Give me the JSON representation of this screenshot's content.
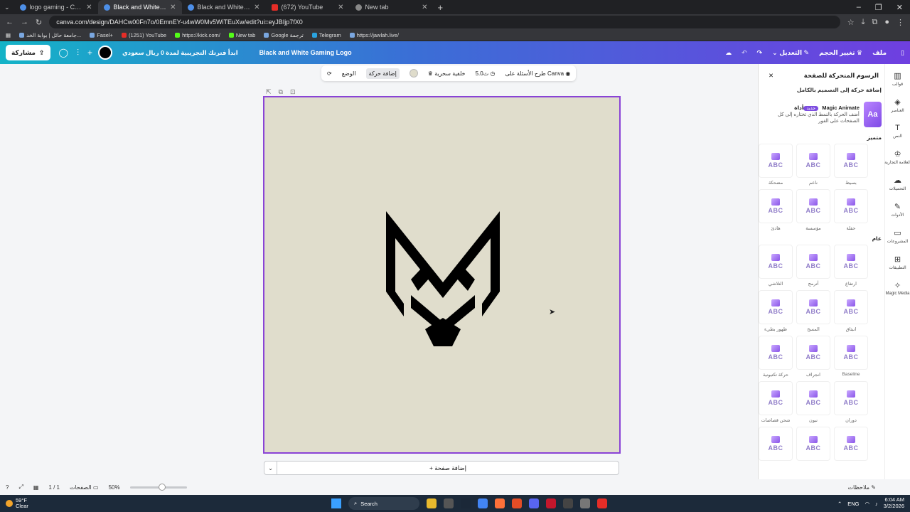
{
  "browser": {
    "tabs": [
      {
        "label": "logo gaming - Canva بحث عن",
        "icon": "canva-favicon",
        "active": false
      },
      {
        "label": "Black and White Gaming Logo",
        "icon": "canva-favicon",
        "active": true
      },
      {
        "label": "Black and White Gaming Logo",
        "icon": "canva-favicon",
        "active": false
      },
      {
        "label": "(672) YouTube",
        "icon": "youtube-favicon",
        "active": false
      },
      {
        "label": "New tab",
        "icon": "chrome-favicon",
        "active": false
      }
    ],
    "new_tab": "+",
    "url": "canva.com/design/DAHCw00Fn7o/0EmnEY-u4wW0Mv5WiTEuXw/edit?ui=eyJBIjp7fX0",
    "bookmarks": [
      "جامعة حائل | بوابة الخد...",
      "Fasel+",
      "(1251) YouTube",
      "https://kick.com/",
      "New tab",
      "Google ترجمة",
      "Telegram",
      "https://jawlah.live/"
    ]
  },
  "topbar": {
    "share_label": "مشاركة",
    "trial_text": "ابدأ فترتك التجريبية لمدة 0 ريال سعودي",
    "doc_title": "Black and White Gaming Logo",
    "file_label": "ملف",
    "resize_label": "تغيير الحجم",
    "edit_label": "التعديل"
  },
  "context_toolbar": {
    "ask_canva": "طرح الأسئلة على Canva",
    "duration": "5.0ث",
    "magic_bg": "خلفية سحرية",
    "add_animation": "إضافة حركة",
    "position": "الوضع"
  },
  "canvas": {
    "bg_color": "#e0ddcc",
    "logo_color": "#000000",
    "add_page_label": "+ إضافة صفحة"
  },
  "panel": {
    "title": "الرسوم المتحركة للصفحة",
    "close_icon": "close-icon",
    "subtitle": "إضافة حركة إلى التصميم بالكامل",
    "magic": {
      "title": "أداة Magic Animate",
      "badge": "جديد",
      "desc": "أضف الحركة بالنمط الذي تختاره إلى كل الصفحات على الفور",
      "thumb_text": "Aa"
    },
    "featured_title": "متميز",
    "featured": [
      "بسيط",
      "ناعم",
      "مضحكة",
      "حفلة",
      "مؤسسة",
      "هادئ"
    ],
    "general_title": "عام",
    "general": [
      "ارتفاع",
      "أترمج",
      "التلاشي",
      "انبثاق",
      "المسح",
      "ظهور بطيء",
      "Baseline",
      "انجراف",
      "حركة تكتيونية",
      "دوران",
      "نبون",
      "شحن قصاصات",
      "",
      "",
      ""
    ]
  },
  "rail": [
    {
      "label": "قوالب",
      "icon": "templates-icon"
    },
    {
      "label": "العناصر",
      "icon": "elements-icon"
    },
    {
      "label": "النص",
      "icon": "text-icon"
    },
    {
      "label": "العلامة التجارية",
      "icon": "brand-icon"
    },
    {
      "label": "التحميلات",
      "icon": "uploads-icon"
    },
    {
      "label": "الأدوات",
      "icon": "tools-icon"
    },
    {
      "label": "المشروعات",
      "icon": "projects-icon"
    },
    {
      "label": "التطبيقات",
      "icon": "apps-icon"
    },
    {
      "label": "Magic Media",
      "icon": "magic-media-icon"
    }
  ],
  "footer": {
    "pages_label": "الصفحات",
    "page_count": "1 / 1",
    "zoom": "50%",
    "notes_label": "ملاحظات"
  },
  "taskbar": {
    "temperature": "59°F",
    "weather": "Clear",
    "search": "Search",
    "lang": "ENG",
    "time": "6:04 AM",
    "date": "3/2/2026"
  }
}
